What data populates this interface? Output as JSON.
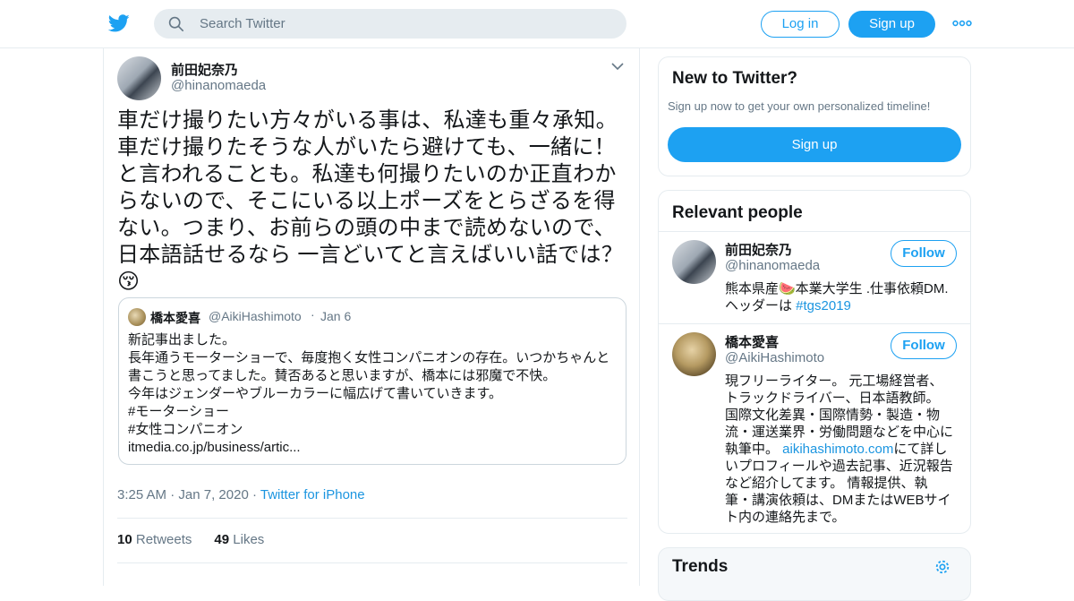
{
  "header": {
    "search_placeholder": "Search Twitter",
    "login_label": "Log in",
    "signup_label": "Sign up",
    "brand_color": "#1da1f2"
  },
  "tweet": {
    "author_name": "前田妃奈乃",
    "author_handle": "@hinanomaeda",
    "text": "車だけ撮りたい方々がいる事は、私達も重々承知。車だけ撮りたそうな人がいたら避けても、一緒に！と言われることも。私達も何撮りたいのか正直わからないので、そこにいる以上ポーズをとらざるを得ない。つまり、お前らの頭の中まで読めないので、日本語話せるなら 一言どいてと言えばいい話では？😚",
    "quoted": {
      "author_name": "橋本愛喜",
      "author_handle": "@AikiHashimoto",
      "separator": "·",
      "date": "Jan 6",
      "lines": [
        "新記事出ました。",
        "長年通うモーターショーで、毎度抱く女性コンパニオンの存在。いつかちゃんと",
        "書こうと思ってました。賛否あると思いますが、橋本には邪魔で不快。",
        "今年はジェンダーやブルーカラーに幅広げて書いていきます。",
        "#モーターショー",
        "#女性コンパニオン",
        "itmedia.co.jp/business/artic..."
      ]
    },
    "time": "3:25 AM",
    "sep1": "·",
    "date": "Jan 7, 2020",
    "sep2": "·",
    "source": "Twitter for iPhone",
    "retweets_count": "10",
    "retweets_label": "Retweets",
    "likes_count": "49",
    "likes_label": "Likes"
  },
  "sidebar": {
    "new_to_twitter": {
      "title": "New to Twitter?",
      "subtitle": "Sign up now to get your own personalized timeline!",
      "button_label": "Sign up"
    },
    "relevant_people": {
      "title": "Relevant people",
      "people": [
        {
          "name": "前田妃奈乃",
          "handle": "@hinanomaeda",
          "follow_label": "Follow",
          "bio_line1": "熊本県産🍉本業大学生 .仕事依頼DM.",
          "bio_line2_text": "ヘッダーは ",
          "bio_line2_link": "#tgs2019"
        },
        {
          "name": "橋本愛喜",
          "handle": "@AikiHashimoto",
          "follow_label": "Follow",
          "bio_lines": [
            "現フリーライター。 元工場経営者、",
            "トラックドライバー、日本語教師。",
            "国際文化差異・国際情勢・製造・物",
            "流・運送業界・労働問題などを中心に"
          ],
          "bio_link_prefix": "執筆中。 ",
          "bio_link": "aikihashimoto.com",
          "bio_link_suffix": "にて詳し",
          "bio_tail_lines": [
            "いプロフィールや過去記事、近況報告",
            "など紹介してます。 情報提供、執",
            "筆・講演依頼は、DMまたはWEBサイ",
            "ト内の連絡先まで。"
          ]
        }
      ]
    },
    "trends": {
      "title": "Trends"
    }
  }
}
